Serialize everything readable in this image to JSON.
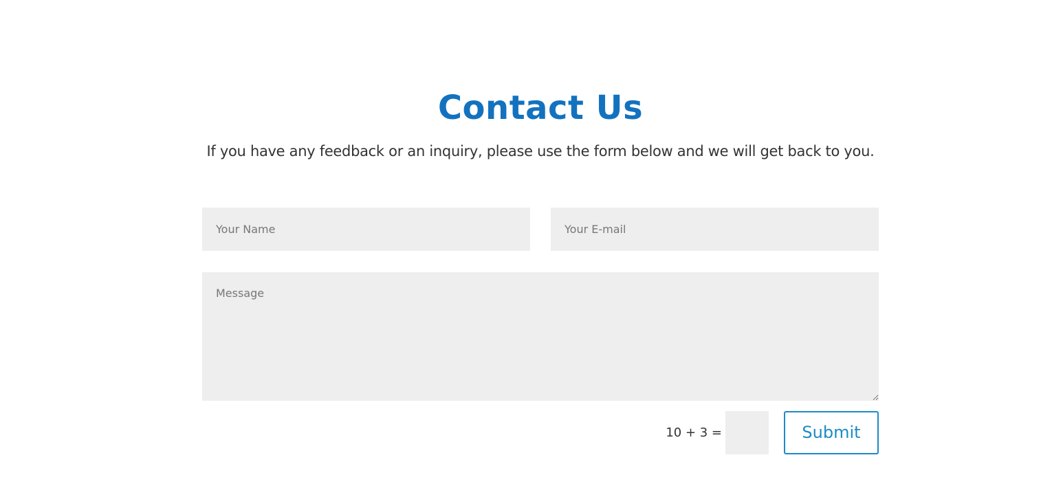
{
  "contact": {
    "title": "Contact Us",
    "subtitle": "If you have any feedback or an inquiry, please use the form below and we will get back to you."
  },
  "form": {
    "name_placeholder": "Your Name",
    "email_placeholder": "Your E-mail",
    "message_placeholder": "Message",
    "captcha_question": "10 + 3 =",
    "submit_label": "Submit"
  },
  "colors": {
    "accent_title": "#1372bf",
    "accent_button": "#1b8bc6",
    "field_background": "#eeeeee",
    "text": "#333333"
  }
}
